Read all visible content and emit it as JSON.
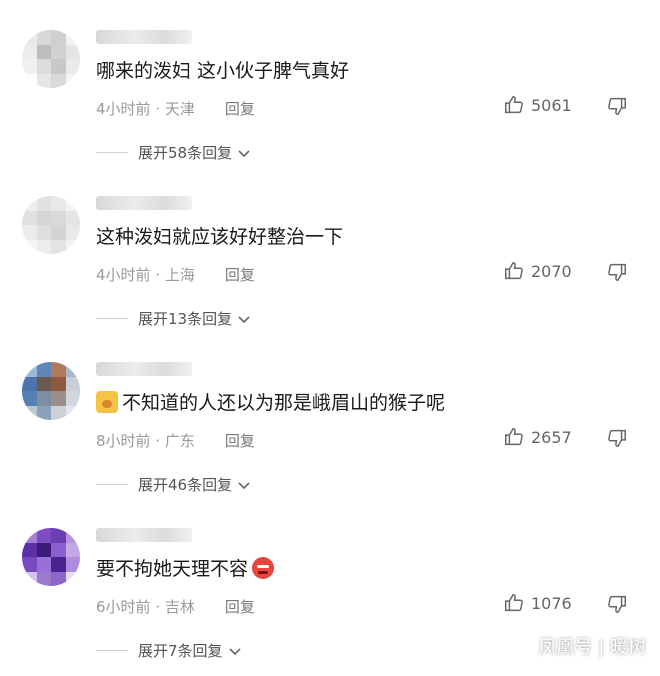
{
  "comments": [
    {
      "text": "哪来的泼妇 这小伙子脾气真好",
      "time": "4小时前",
      "location": "天津",
      "reply_label": "回复",
      "likes": "5061",
      "expand_label": "展开58条回复",
      "avatar_colors": [
        "#e9e9e9",
        "#d8d8d8",
        "#cfcfcf",
        "#f2f2f2",
        "#ececec",
        "#bdbdbd",
        "#d1d1d1",
        "#e4e4e4",
        "#f0f0f0",
        "#dcdcdc",
        "#c8c8c8",
        "#eaeaea",
        "#ffffff",
        "#e6e6e6",
        "#d9d9d9",
        "#f4f4f4"
      ]
    },
    {
      "text": "这种泼妇就应该好好整治一下",
      "time": "4小时前",
      "location": "上海",
      "reply_label": "回复",
      "likes": "2070",
      "expand_label": "展开13条回复",
      "avatar_colors": [
        "#eeeeee",
        "#e2e2e2",
        "#e8e8e8",
        "#f3f3f3",
        "#e0e0e0",
        "#d6d6d6",
        "#dadada",
        "#e5e5e5",
        "#ebebeb",
        "#dedede",
        "#d4d4d4",
        "#e9e9e9",
        "#f5f5f5",
        "#ececec",
        "#e3e3e3",
        "#f1f1f1"
      ]
    },
    {
      "text": "不知道的人还以为那是峨眉山的猴子呢",
      "time": "8小时前",
      "location": "广东",
      "reply_label": "回复",
      "likes": "2657",
      "expand_label": "展开46条回复",
      "avatar_colors": [
        "#9fb8d6",
        "#5f86b8",
        "#b07a5a",
        "#a9b7c8",
        "#4b76ad",
        "#6a5a52",
        "#8e5a3e",
        "#c6ced8",
        "#5580b4",
        "#7d8ea3",
        "#9a8f88",
        "#d0d6de",
        "#b9c6d6",
        "#8aa1bd",
        "#cbd2da",
        "#e2e6ea"
      ]
    },
    {
      "text": "要不拘她天理不容",
      "time": "6小时前",
      "location": "吉林",
      "reply_label": "回复",
      "likes": "1076",
      "expand_label": "展开7条回复",
      "avatar_colors": [
        "#a67fd4",
        "#7d4cc2",
        "#6a3db3",
        "#b894e0",
        "#5d2fa6",
        "#3d1b7a",
        "#8b5fd0",
        "#c4a8e6",
        "#7a48c0",
        "#9b6fd8",
        "#4a2590",
        "#b08be0",
        "#d6c4ef",
        "#9c7acc",
        "#8e66c8",
        "#e6dcf4"
      ]
    }
  ],
  "watermark": "凤凰号 | 暖树",
  "icons": {
    "like": "thumb-up-icon",
    "dislike": "thumb-down-icon",
    "expand": "chevron-down-icon"
  }
}
